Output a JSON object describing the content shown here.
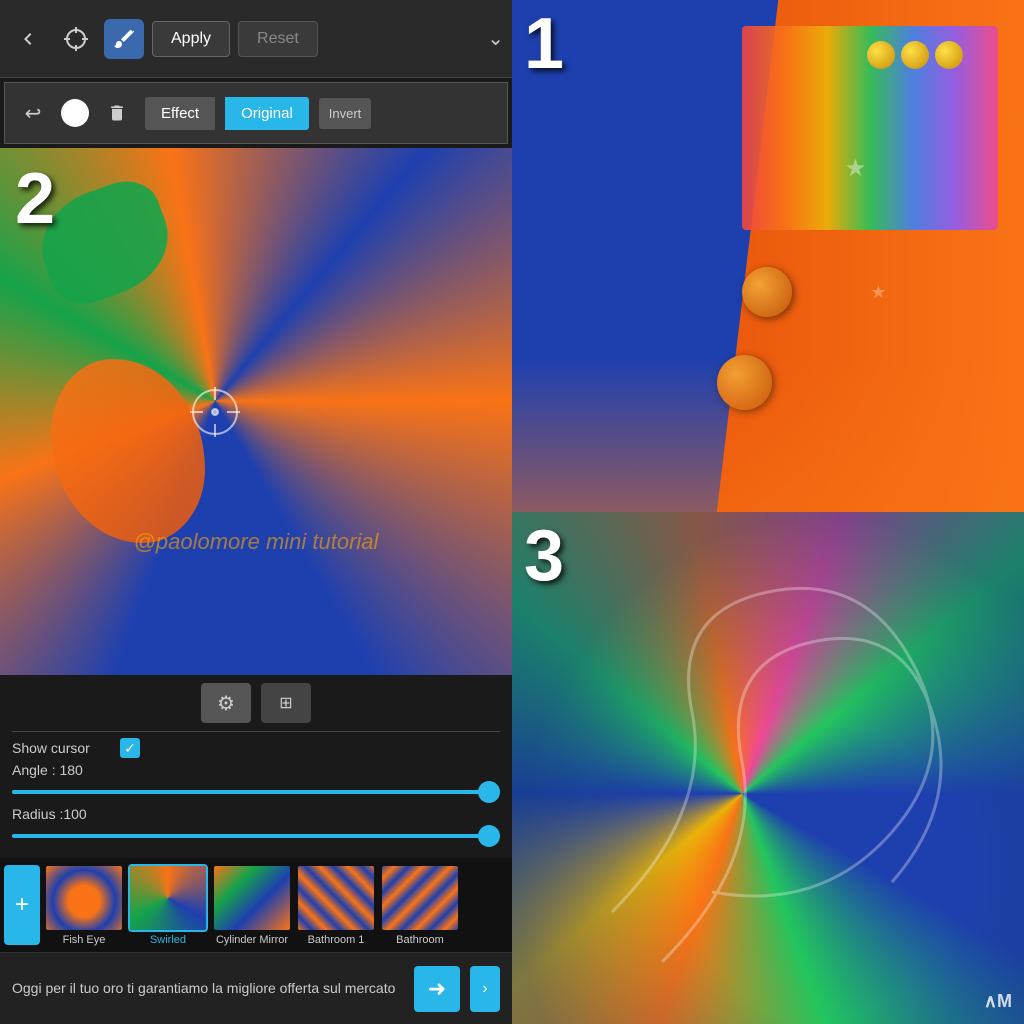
{
  "toolbar": {
    "apply_label": "Apply",
    "reset_label": "Reset"
  },
  "secondary_toolbar": {
    "effect_tab_label": "Effect",
    "original_tab_label": "Original",
    "invert_label": "Invert"
  },
  "settings": {
    "show_cursor_label": "Show cursor",
    "angle_label": "Angle : 180",
    "radius_label": "Radius :100",
    "angle_value": 180,
    "radius_value": 100
  },
  "filters": [
    {
      "label": "Fish Eye",
      "selected": false
    },
    {
      "label": "Swirled",
      "selected": true
    },
    {
      "label": "Cylinder Mirror",
      "selected": false
    },
    {
      "label": "Bathroom 1",
      "selected": false
    },
    {
      "label": "Bathroom",
      "selected": false
    }
  ],
  "ad_banner": {
    "text": "Oggi per il tuo oro ti garantiamo la migliore offerta sul mercato"
  },
  "watermark": "@paolomore mini tutorial",
  "step_numbers": {
    "step1": "1",
    "step2": "2",
    "step3": "3"
  }
}
